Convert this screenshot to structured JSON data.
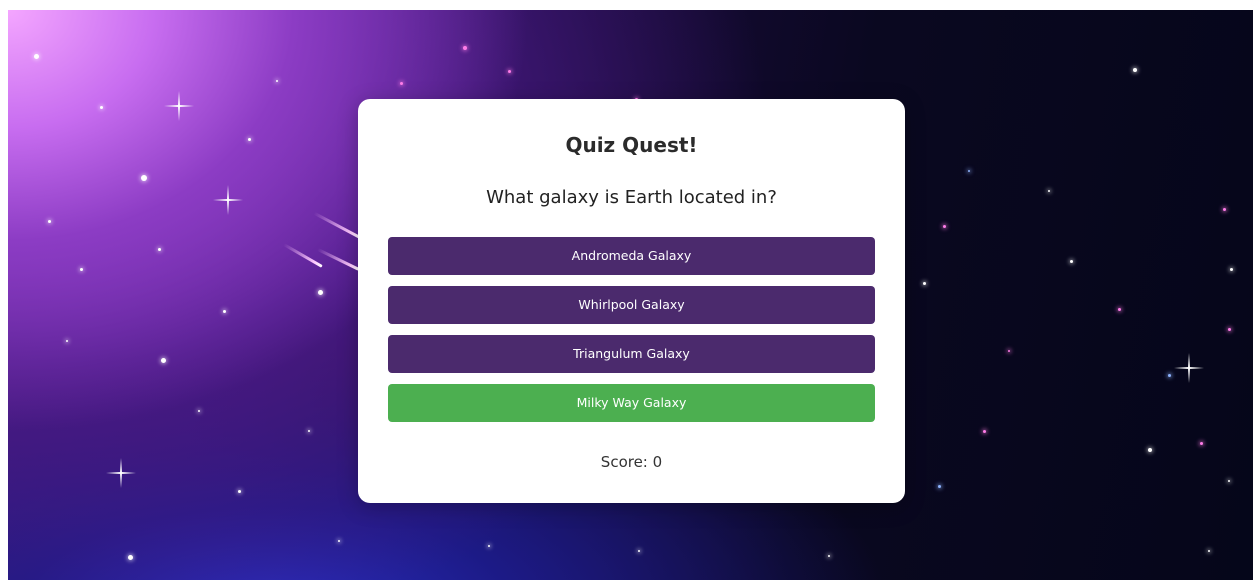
{
  "quiz": {
    "title": "Quiz Quest!",
    "question": "What galaxy is Earth located in?",
    "answers": [
      {
        "label": "Andromeda Galaxy",
        "state": "default"
      },
      {
        "label": "Whirlpool Galaxy",
        "state": "default"
      },
      {
        "label": "Triangulum Galaxy",
        "state": "default"
      },
      {
        "label": "Milky Way Galaxy",
        "state": "correct"
      }
    ],
    "score_text": "Score: 0"
  },
  "colors": {
    "answer_default": "#4b2a6d",
    "answer_correct": "#4caf50",
    "card_background": "#ffffff"
  }
}
